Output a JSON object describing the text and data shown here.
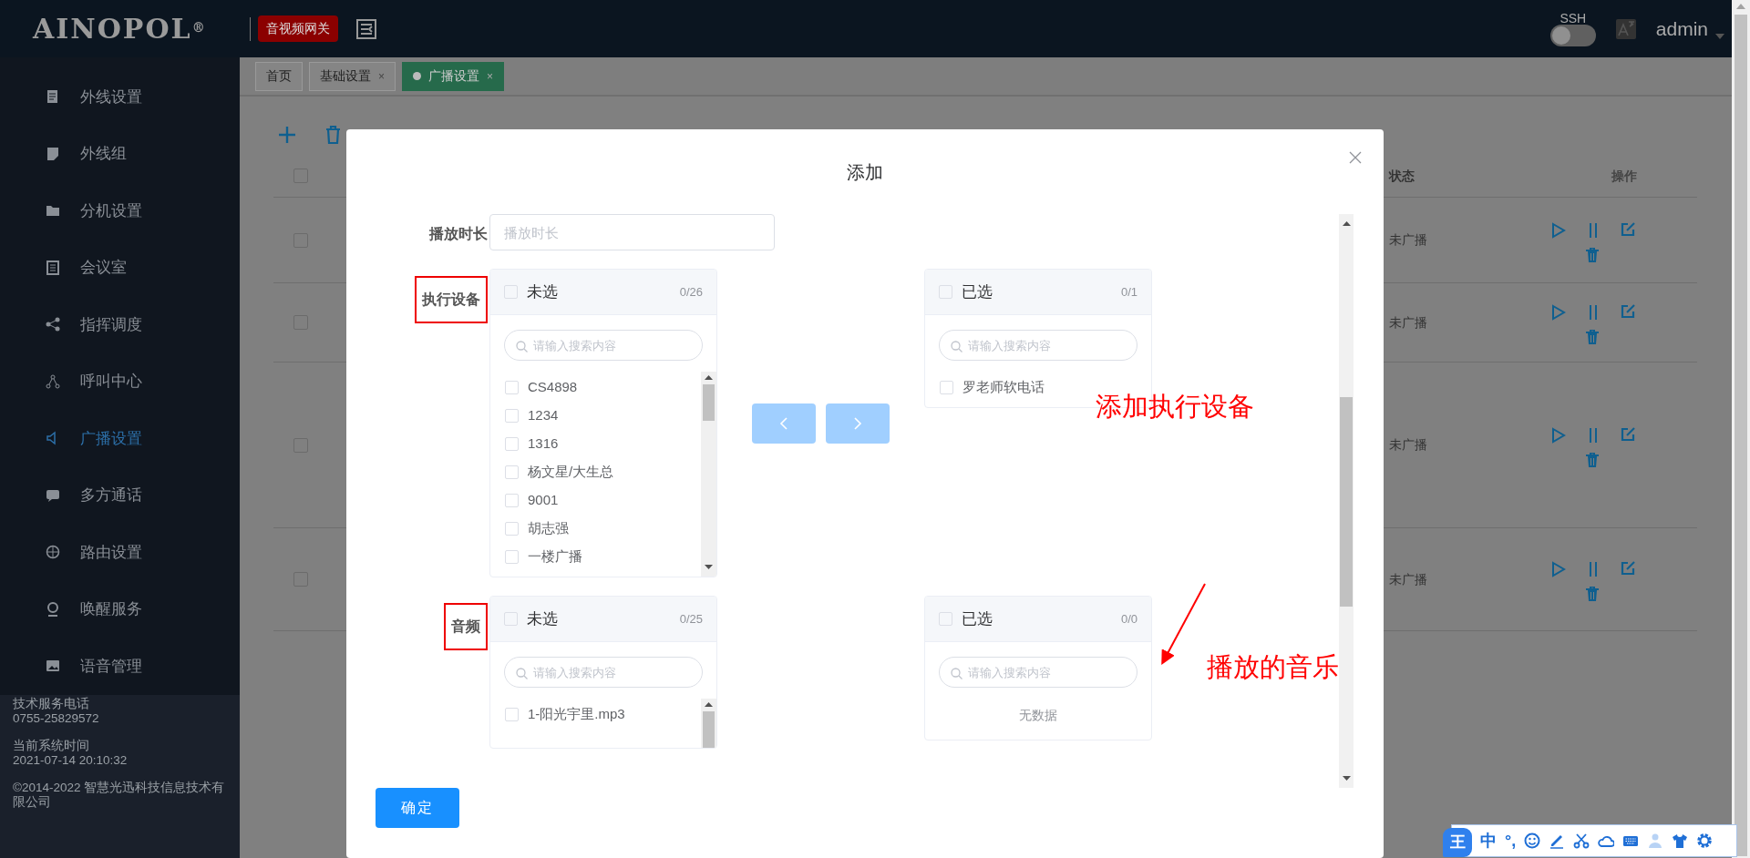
{
  "header": {
    "logo": "AINOPOL",
    "logo_mark": "®",
    "badge": "音视频网关",
    "ssh_label": "SSH",
    "ssh_on": false,
    "user": "admin"
  },
  "sidebar": {
    "items": [
      {
        "label": "外线设置",
        "selected": false
      },
      {
        "label": "外线组",
        "selected": false
      },
      {
        "label": "分机设置",
        "selected": false
      },
      {
        "label": "会议室",
        "selected": false
      },
      {
        "label": "指挥调度",
        "selected": false
      },
      {
        "label": "呼叫中心",
        "selected": false
      },
      {
        "label": "广播设置",
        "selected": true
      },
      {
        "label": "多方通话",
        "selected": false
      },
      {
        "label": "路由设置",
        "selected": false
      },
      {
        "label": "唤醒服务",
        "selected": false
      },
      {
        "label": "语音管理",
        "selected": false
      }
    ],
    "footer": [
      {
        "label": "技术服务电话",
        "value": "0755-25829572"
      },
      {
        "label": "当前系统时间",
        "value": "2021-07-14 20:10:32"
      },
      {
        "label": "©2014-2022 智慧光迅科技信息技术有限公司"
      }
    ]
  },
  "tabs": [
    {
      "label": "首页",
      "selected": false
    },
    {
      "label": "基础设置",
      "selected": false,
      "close": "×"
    },
    {
      "label": "广播设置",
      "selected": true,
      "close": "×"
    }
  ],
  "table": {
    "columns": [
      "状态",
      "操作"
    ],
    "all_checked": false,
    "rows": [
      {
        "status": "未广播",
        "checked": false
      },
      {
        "status": "未广播",
        "checked": false
      },
      {
        "status": "未广播",
        "checked": false
      },
      {
        "status": "未广播",
        "checked": false
      }
    ]
  },
  "modal": {
    "title": "添加",
    "fields": [
      {
        "kind": "input",
        "label": "播放时长",
        "placeholder": "播放时长",
        "highlighted": false
      },
      {
        "kind": "transfer",
        "label": "执行设备",
        "highlighted": true,
        "annotation": "添加执行设备",
        "annotation_arrow": false,
        "source": {
          "title": "未选",
          "count": "0/26",
          "checked": false,
          "placeholder": "请输入搜索内容",
          "scrollable": true,
          "items": [
            {
              "label": "CS4898",
              "checked": false
            },
            {
              "label": "1234",
              "checked": false
            },
            {
              "label": "1316",
              "checked": false
            },
            {
              "label": "杨文星/大生总",
              "checked": false
            },
            {
              "label": "9001",
              "checked": false
            },
            {
              "label": "胡志强",
              "checked": false
            },
            {
              "label": "一楼广播",
              "checked": false
            }
          ]
        },
        "buttons": [
          {
            "kind": "left",
            "disabled": true
          },
          {
            "kind": "right",
            "disabled": true
          }
        ],
        "target": {
          "title": "已选",
          "count": "0/1",
          "checked": false,
          "placeholder": "请输入搜索内容",
          "items": [
            {
              "label": "罗老师软电话",
              "checked": false
            }
          ]
        }
      },
      {
        "kind": "transfer",
        "label": "音频",
        "highlighted": true,
        "annotation": "播放的音乐",
        "annotation_arrow": true,
        "source": {
          "title": "未选",
          "count": "0/25",
          "checked": false,
          "placeholder": "请输入搜索内容",
          "scrollable": true,
          "items": [
            {
              "label": "1-阳光宇里.mp3",
              "checked": false
            }
          ]
        },
        "target": {
          "title": "已选",
          "count": "0/0",
          "checked": false,
          "placeholder": "请输入搜索内容",
          "empty_text": "无数据"
        }
      }
    ],
    "submit": "确定"
  },
  "ime": {
    "logo": "王",
    "mode": "中",
    "punct": "°,"
  }
}
